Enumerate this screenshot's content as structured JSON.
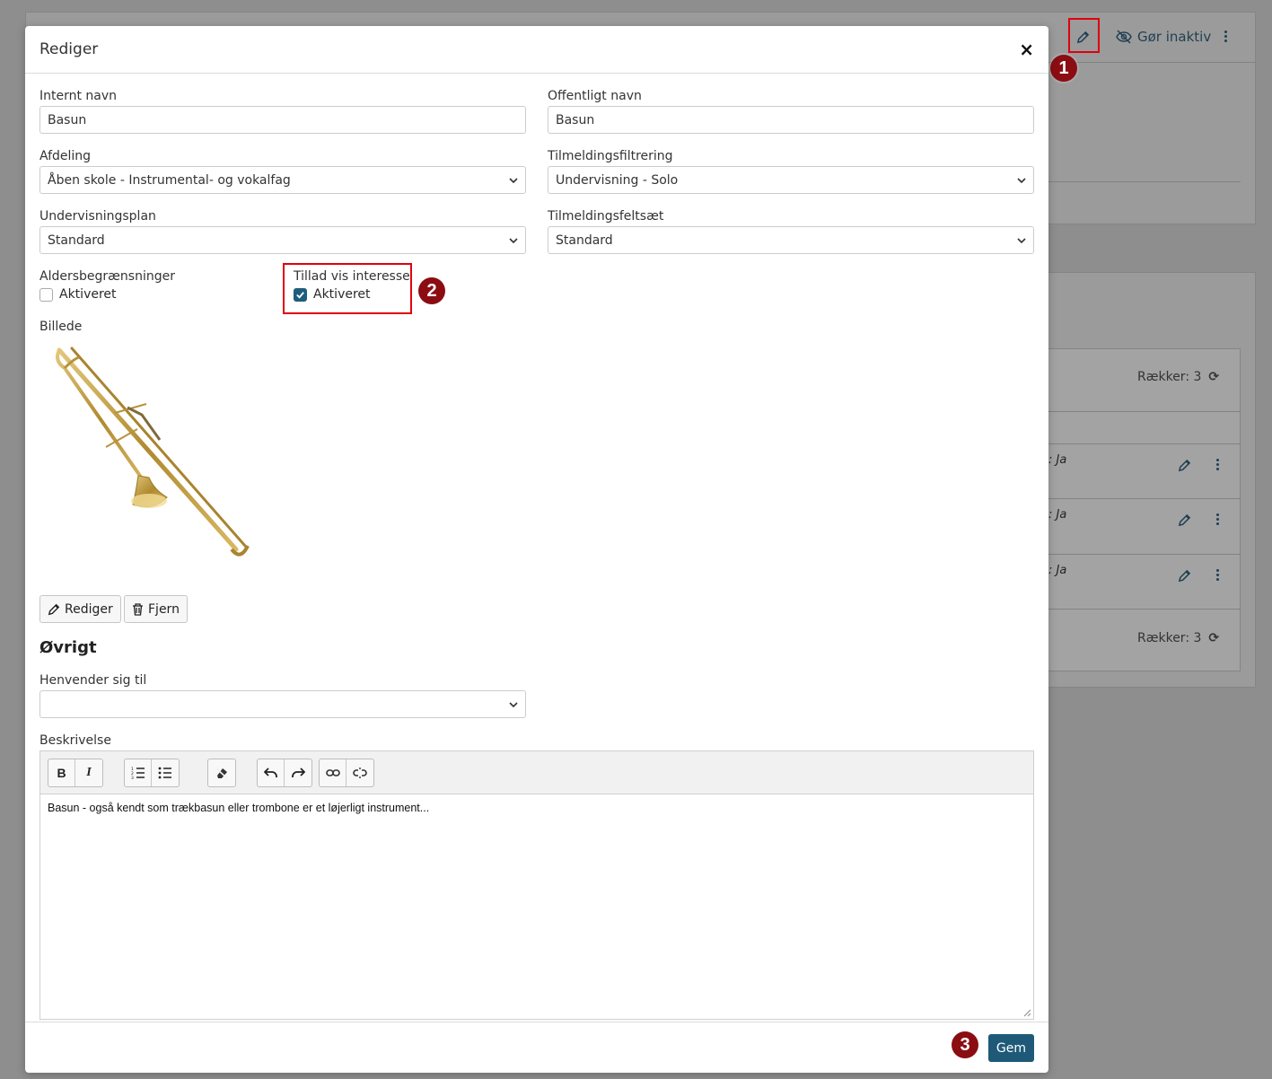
{
  "background": {
    "header_actions": {
      "inactive_label": "Gør inaktiv"
    },
    "rows_count_label": "Rækker: 3",
    "row_texts": [
      ": Ja",
      ": Ja",
      ": Ja"
    ]
  },
  "annotations": {
    "marker1": "1",
    "marker2": "2",
    "marker3": "3"
  },
  "modal": {
    "title": "Rediger",
    "close_symbol": "×",
    "fields": {
      "internal_name": {
        "label": "Internt navn",
        "value": "Basun"
      },
      "public_name": {
        "label": "Offentligt navn",
        "value": "Basun"
      },
      "department": {
        "label": "Afdeling",
        "value": "Åben skole - Instrumental- og vokalfag"
      },
      "registration_filter": {
        "label": "Tilmeldingsfiltrering",
        "value": "Undervisning - Solo"
      },
      "teaching_plan": {
        "label": "Undervisningsplan",
        "value": "Standard"
      },
      "registration_fieldset": {
        "label": "Tilmeldingsfeltsæt",
        "value": "Standard"
      },
      "age_limits": {
        "label": "Aldersbegrænsninger",
        "checkbox_label": "Aktiveret",
        "checked": false
      },
      "allow_interest": {
        "label": "Tillad vis interesse",
        "checkbox_label": "Aktiveret",
        "checked": true
      }
    },
    "image_section": {
      "label": "Billede",
      "edit_label": "Rediger",
      "remove_label": "Fjern"
    },
    "other_section": {
      "title": "Øvrigt",
      "addressed_to": {
        "label": "Henvender sig til",
        "value": ""
      },
      "description": {
        "label": "Beskrivelse",
        "text": "Basun - også kendt som trækbasun eller trombone er et løjerligt instrument..."
      }
    },
    "save_label": "Gem"
  },
  "colors": {
    "accent": "#1e5a78",
    "highlight": "#e0000f",
    "marker": "#8b0d12"
  }
}
